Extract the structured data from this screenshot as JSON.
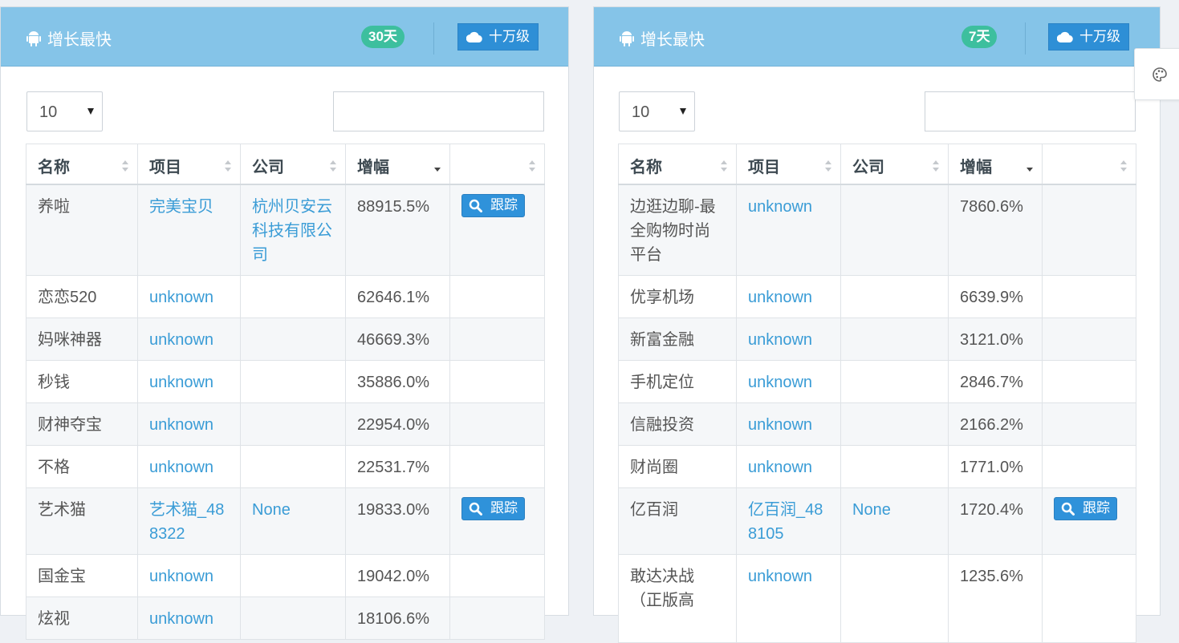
{
  "panels": [
    {
      "title": "增长最快",
      "period_badge": "30天",
      "level_button": "十万级",
      "page_size": "10",
      "search_placeholder": "",
      "columns": [
        "名称",
        "项目",
        "公司",
        "增幅",
        ""
      ],
      "rows": [
        {
          "name": "养啦",
          "project": "完美宝贝",
          "company": "杭州贝安云科技有限公司",
          "growth": "88915.5%",
          "track": "跟踪"
        },
        {
          "name": "恋恋520",
          "project": "unknown",
          "company": "",
          "growth": "62646.1%",
          "track": ""
        },
        {
          "name": "妈咪神器",
          "project": "unknown",
          "company": "",
          "growth": "46669.3%",
          "track": ""
        },
        {
          "name": "秒钱",
          "project": "unknown",
          "company": "",
          "growth": "35886.0%",
          "track": ""
        },
        {
          "name": "财神夺宝",
          "project": "unknown",
          "company": "",
          "growth": "22954.0%",
          "track": ""
        },
        {
          "name": "不格",
          "project": "unknown",
          "company": "",
          "growth": "22531.7%",
          "track": ""
        },
        {
          "name": "艺术猫",
          "project": "艺术猫_488322",
          "company": "None",
          "growth": "19833.0%",
          "track": "跟踪"
        },
        {
          "name": "国金宝",
          "project": "unknown",
          "company": "",
          "growth": "19042.0%",
          "track": ""
        },
        {
          "name": "炫视",
          "project": "unknown",
          "company": "",
          "growth": "18106.6%",
          "track": ""
        }
      ]
    },
    {
      "title": "增长最快",
      "period_badge": "7天",
      "level_button": "十万级",
      "page_size": "10",
      "search_placeholder": "",
      "columns": [
        "名称",
        "项目",
        "公司",
        "增幅",
        ""
      ],
      "rows": [
        {
          "name": "边逛边聊-最全购物时尚平台",
          "project": "unknown",
          "company": "",
          "growth": "7860.6%",
          "track": ""
        },
        {
          "name": "优享机场",
          "project": "unknown",
          "company": "",
          "growth": "6639.9%",
          "track": ""
        },
        {
          "name": "新富金融",
          "project": "unknown",
          "company": "",
          "growth": "3121.0%",
          "track": ""
        },
        {
          "name": "手机定位",
          "project": "unknown",
          "company": "",
          "growth": "2846.7%",
          "track": ""
        },
        {
          "name": "信融投资",
          "project": "unknown",
          "company": "",
          "growth": "2166.2%",
          "track": ""
        },
        {
          "name": "财尚圈",
          "project": "unknown",
          "company": "",
          "growth": "1771.0%",
          "track": ""
        },
        {
          "name": "亿百润",
          "project": "亿百润_488105",
          "company": "None",
          "growth": "1720.4%",
          "track": "跟踪"
        },
        {
          "name": "敢达决战（正版高",
          "project": "unknown",
          "company": "",
          "growth": "1235.6%",
          "track": ""
        }
      ]
    }
  ],
  "colors": {
    "header_bg": "#85c4e8",
    "badge_green": "#3dbf9e",
    "button_blue": "#2e8fd6",
    "link_blue": "#3a9cd6"
  },
  "icons": [
    "android-icon",
    "cloud-icon",
    "sort-icon",
    "search-icon",
    "palette-icon"
  ]
}
